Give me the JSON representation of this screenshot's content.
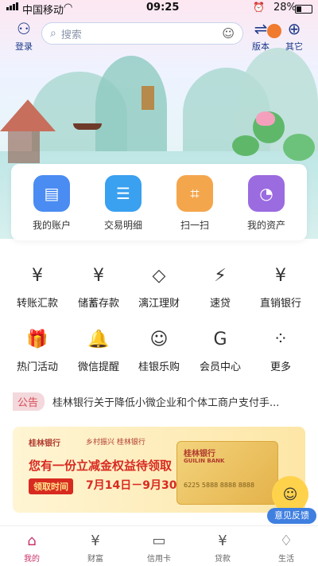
{
  "status_bar": {
    "carrier": "中国移动",
    "time": "09:25",
    "battery": "28%"
  },
  "header": {
    "login_label": "登录",
    "search_placeholder": "搜索",
    "version_label": "版本",
    "other_label": "其它"
  },
  "quick_actions": [
    {
      "label": "我的账户",
      "icon": "account-card-icon",
      "color": "#4a8cf2"
    },
    {
      "label": "交易明细",
      "icon": "transaction-list-icon",
      "color": "#3aa0f0"
    },
    {
      "label": "扫一扫",
      "icon": "scan-icon",
      "color": "#f4a64d"
    },
    {
      "label": "我的资产",
      "icon": "assets-pie-icon",
      "color": "#9b6be0"
    }
  ],
  "services": [
    {
      "label": "转账汇款",
      "icon": "transfer-icon",
      "glyph": "¥"
    },
    {
      "label": "储蓄存款",
      "icon": "savings-icon",
      "glyph": "¥"
    },
    {
      "label": "漓江理财",
      "icon": "wealth-icon",
      "glyph": "◇"
    },
    {
      "label": "速贷",
      "icon": "loan-icon",
      "glyph": "⚡"
    },
    {
      "label": "直销银行",
      "icon": "direct-bank-icon",
      "glyph": "¥"
    },
    {
      "label": "热门活动",
      "icon": "gift-icon",
      "glyph": "🎁"
    },
    {
      "label": "微信提醒",
      "icon": "wechat-alert-icon",
      "glyph": "🔔"
    },
    {
      "label": "桂银乐购",
      "icon": "shopping-bag-icon",
      "glyph": "☺"
    },
    {
      "label": "会员中心",
      "icon": "member-icon",
      "glyph": "G"
    },
    {
      "label": "更多",
      "icon": "more-grid-icon",
      "glyph": "⁘"
    }
  ],
  "notice": {
    "badge": "公告",
    "text": "桂林银行关于降低小微企业和个体工商户支付手..."
  },
  "banner": {
    "bank_name": "桂林银行",
    "brand_sub": "GUILIN BANK",
    "partner_text": "乡村振兴 桂林银行",
    "title": "您有一份立减金权益待领取",
    "time_label": "领取时间",
    "date_range": "7月14日－9月30日",
    "card_number": "6225 5888 8888 8888"
  },
  "feedback": {
    "label": "意见反馈"
  },
  "tabbar": [
    {
      "label": "我的",
      "icon": "home-icon",
      "glyph": "⌂",
      "active": true
    },
    {
      "label": "财富",
      "icon": "wealth-tab-icon",
      "glyph": "¥",
      "active": false
    },
    {
      "label": "信用卡",
      "icon": "credit-card-icon",
      "glyph": "▭",
      "active": false
    },
    {
      "label": "贷款",
      "icon": "loan-tab-icon",
      "glyph": "¥",
      "active": false
    },
    {
      "label": "生活",
      "icon": "life-bag-icon",
      "glyph": "♢",
      "active": false
    }
  ]
}
